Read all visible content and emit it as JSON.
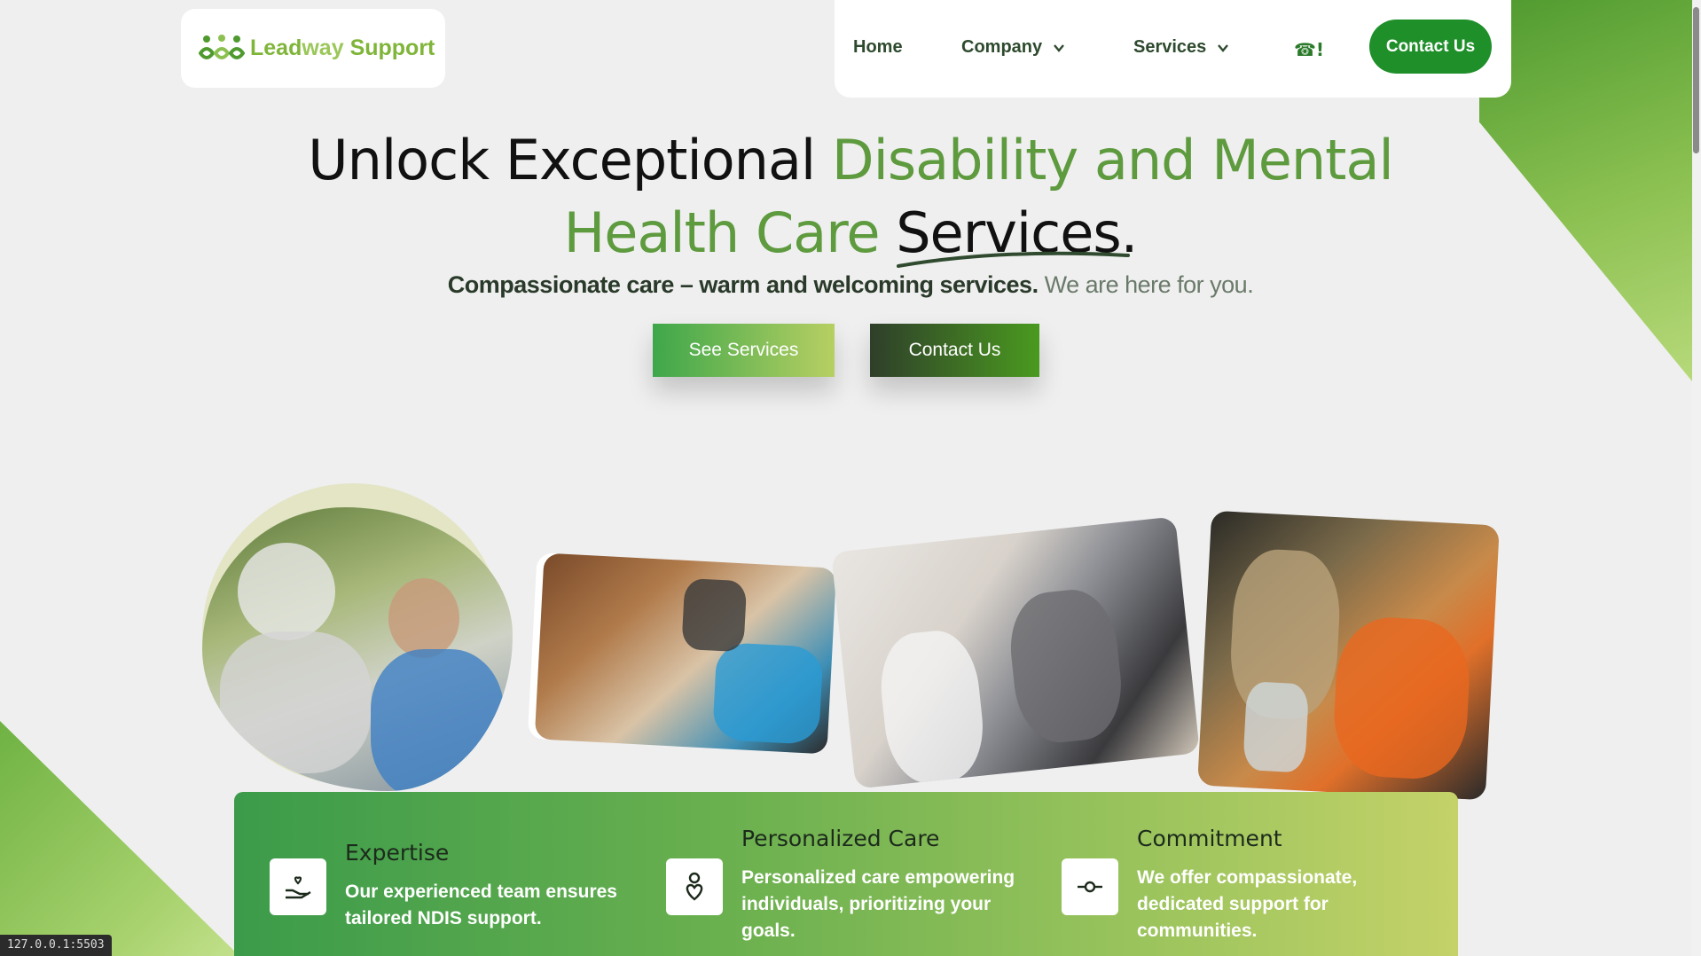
{
  "colors": {
    "accent_green": "#5e9a3e",
    "nav_button": "#1f8f2a",
    "dark_green": "#2f3f2a"
  },
  "logo": {
    "text_main": "Lead",
    "text_light": "way",
    "text_rest": " Support"
  },
  "nav": {
    "items": [
      {
        "label": "Home",
        "has_dropdown": false
      },
      {
        "label": "Company",
        "has_dropdown": true
      },
      {
        "label": "Services",
        "has_dropdown": true
      }
    ],
    "phone": "☎!",
    "contact_label": "Contact Us"
  },
  "hero": {
    "title_part1": "Unlock Exceptional ",
    "title_green1": "Disability and Mental",
    "title_green2": "Health Care ",
    "title_part2": "Services.",
    "subtitle_bold": "Compassionate care – warm and welcoming services.",
    "subtitle_muted": " We are here for you.",
    "btn_see": "See Services",
    "btn_contact": "Contact Us"
  },
  "features": [
    {
      "icon": "hand-heart-icon",
      "title": "Expertise",
      "text": "Our experienced team ensures tailored NDIS support."
    },
    {
      "icon": "person-heart-icon",
      "title": "Personalized Care",
      "text": "Personalized care empowering individuals, prioritizing your goals."
    },
    {
      "icon": "commit-icon",
      "title": "Commitment",
      "text": "We offer compassionate, dedicated support for communities."
    }
  ],
  "status_url": "127.0.0.1:5503"
}
